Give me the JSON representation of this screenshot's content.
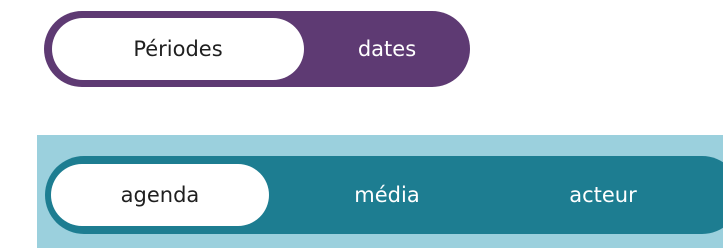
{
  "colors": {
    "top_toggle_bg": "#5e3a73",
    "bottom_panel_bg": "#9bd0dd",
    "bottom_toggle_bg": "#1d7d91",
    "active_segment_bg": "#ffffff",
    "active_text": "#1f1f1f",
    "inactive_text": "#ffffff"
  },
  "toggle_top": {
    "options": [
      {
        "label": "Périodes",
        "selected": true
      },
      {
        "label": "dates",
        "selected": false
      }
    ]
  },
  "toggle_bottom": {
    "options": [
      {
        "label": "agenda",
        "selected": true
      },
      {
        "label": "média",
        "selected": false
      },
      {
        "label": "acteur",
        "selected": false
      }
    ]
  }
}
